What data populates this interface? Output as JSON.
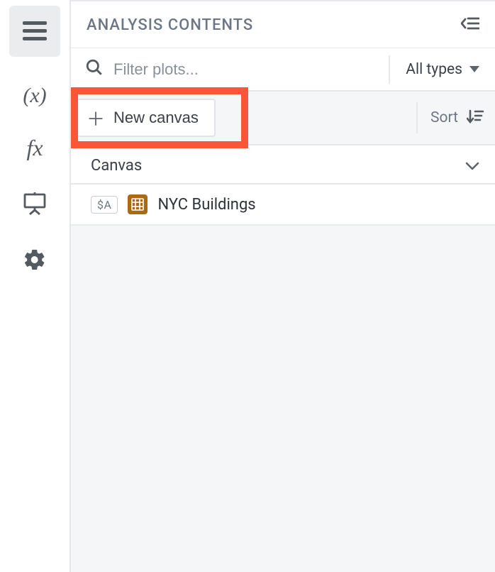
{
  "header": {
    "title": "ANALYSIS CONTENTS"
  },
  "filter": {
    "placeholder": "Filter plots...",
    "type_selected": "All types"
  },
  "toolbar": {
    "new_canvas_label": "New canvas",
    "sort_label": "Sort"
  },
  "section": {
    "title": "Canvas"
  },
  "items": [
    {
      "badge": "$A",
      "name": "NYC Buildings"
    }
  ]
}
